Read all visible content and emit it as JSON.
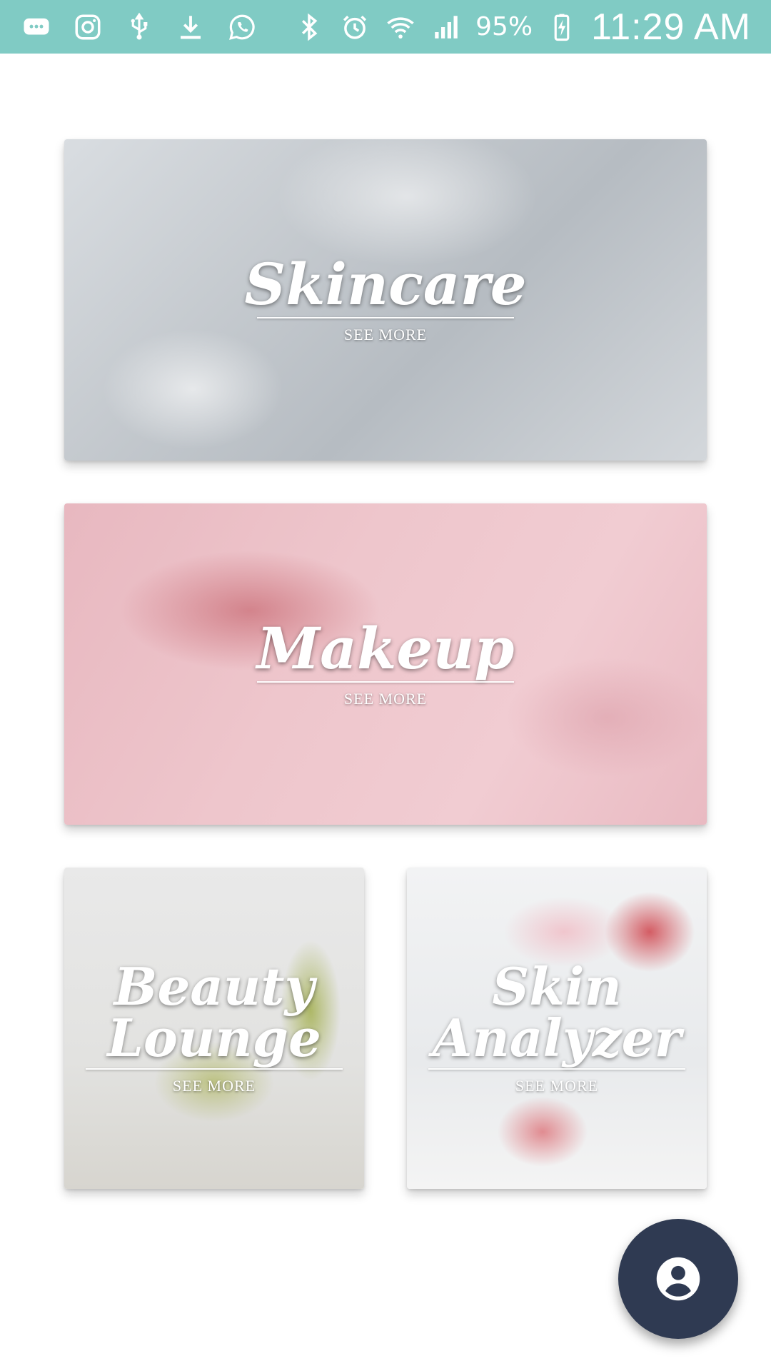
{
  "status_bar": {
    "icons": [
      "chat-bubble-icon",
      "instagram-icon",
      "usb-icon",
      "download-icon",
      "whatsapp-icon",
      "bluetooth-icon",
      "alarm-icon",
      "wifi-icon",
      "signal-icon",
      "battery-charging-icon"
    ],
    "battery_percent": "95%",
    "time": "11:29 AM",
    "background_color": "#80CBC4"
  },
  "cards": {
    "skincare": {
      "title": "Skincare",
      "action": "SEE MORE"
    },
    "makeup": {
      "title": "Makeup",
      "action": "SEE MORE"
    },
    "beauty_lounge": {
      "title_line1": "Beauty",
      "title_line2": "Lounge",
      "action": "SEE MORE"
    },
    "skin_analyzer": {
      "title_line1": "Skin",
      "title_line2": "Analyzer",
      "action": "SEE MORE"
    }
  },
  "fab": {
    "icon": "account-circle-icon",
    "color": "#2f3a52"
  }
}
